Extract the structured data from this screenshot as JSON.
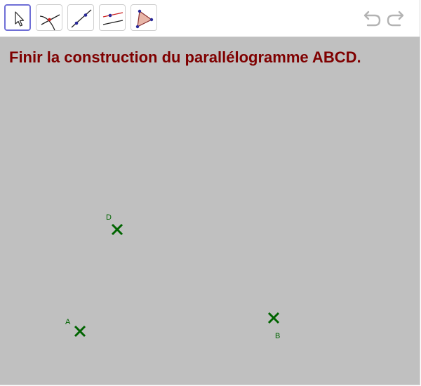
{
  "toolbar": {
    "tools": [
      {
        "name": "move-tool",
        "icon": "arrow-pointer-icon"
      },
      {
        "name": "intersect-tool",
        "icon": "intersect-icon"
      },
      {
        "name": "line-tool",
        "icon": "line-through-points-icon"
      },
      {
        "name": "parallel-line-tool",
        "icon": "parallel-line-icon"
      },
      {
        "name": "polygon-tool",
        "icon": "polygon-icon"
      }
    ],
    "selected_tool": "move-tool",
    "undo_icon": "undo-icon",
    "redo_icon": "redo-icon"
  },
  "canvas": {
    "instruction": "Finir la construction du parallélogramme ABCD."
  },
  "points": {
    "a": {
      "label": "A"
    },
    "b": {
      "label": "B"
    },
    "d": {
      "label": "D"
    }
  },
  "colors": {
    "title": "#7f0000",
    "point": "#006400",
    "canvas": "#c0c0c0",
    "selection": "#6f6fd6"
  }
}
